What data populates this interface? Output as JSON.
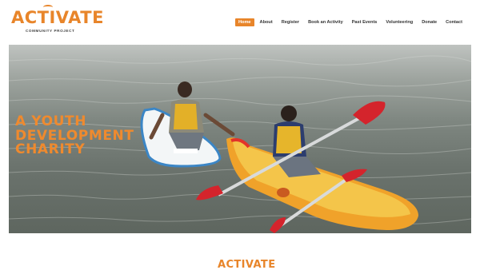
{
  "brand": {
    "name": "ACTIVATE",
    "tagline": "COMMUNITY PROJECT",
    "color": "#e8852a"
  },
  "nav": {
    "items": [
      {
        "label": "Home",
        "active": true
      },
      {
        "label": "About",
        "active": false
      },
      {
        "label": "Register",
        "active": false
      },
      {
        "label": "Book an Activity",
        "active": false
      },
      {
        "label": "Past Events",
        "active": false
      },
      {
        "label": "Volunteering",
        "active": false
      },
      {
        "label": "Donate",
        "active": false
      },
      {
        "label": "Contact",
        "active": false
      }
    ]
  },
  "hero": {
    "title_lines": [
      "A YOUTH",
      "DEVELOPMENT",
      "CHARITY"
    ],
    "title_color": "#ef8a2e"
  },
  "footer": {
    "logo_text": "ACTIVATE"
  }
}
